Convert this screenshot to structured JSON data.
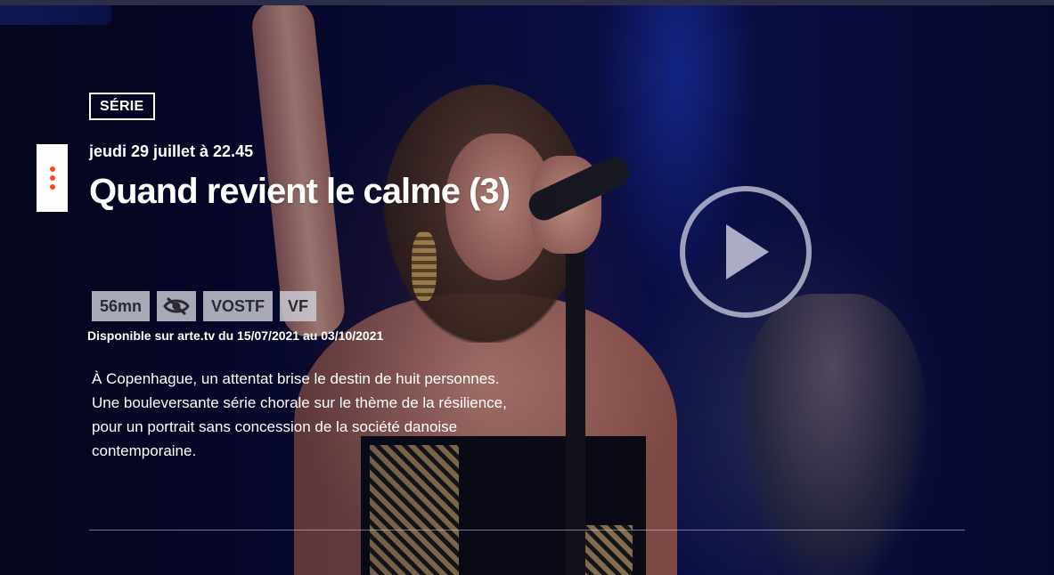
{
  "program": {
    "genre": "SÉRIE",
    "broadcast_date": "jeudi 29 juillet à 22.45",
    "title": "Quand revient le calme (3)",
    "availability": "Disponible sur arte.tv du 15/07/2021 au 03/10/2021",
    "description": "À Copenhague, un attentat brise le destin de huit personnes. Une bouleversante série chorale sur le thème de la résilience, pour un portrait sans concession de la société danoise contemporaine."
  },
  "badges": {
    "duration": "56mn",
    "subtitles_icon": "eye-slash-icon",
    "vostf": "VOSTF",
    "vf": "VF"
  },
  "icons": {
    "menu": "three-dots-vertical-icon",
    "play": "play-icon"
  },
  "colors": {
    "accent": "#fa481c",
    "background": "#07082a",
    "badge_bg": "#cdcdd7"
  }
}
